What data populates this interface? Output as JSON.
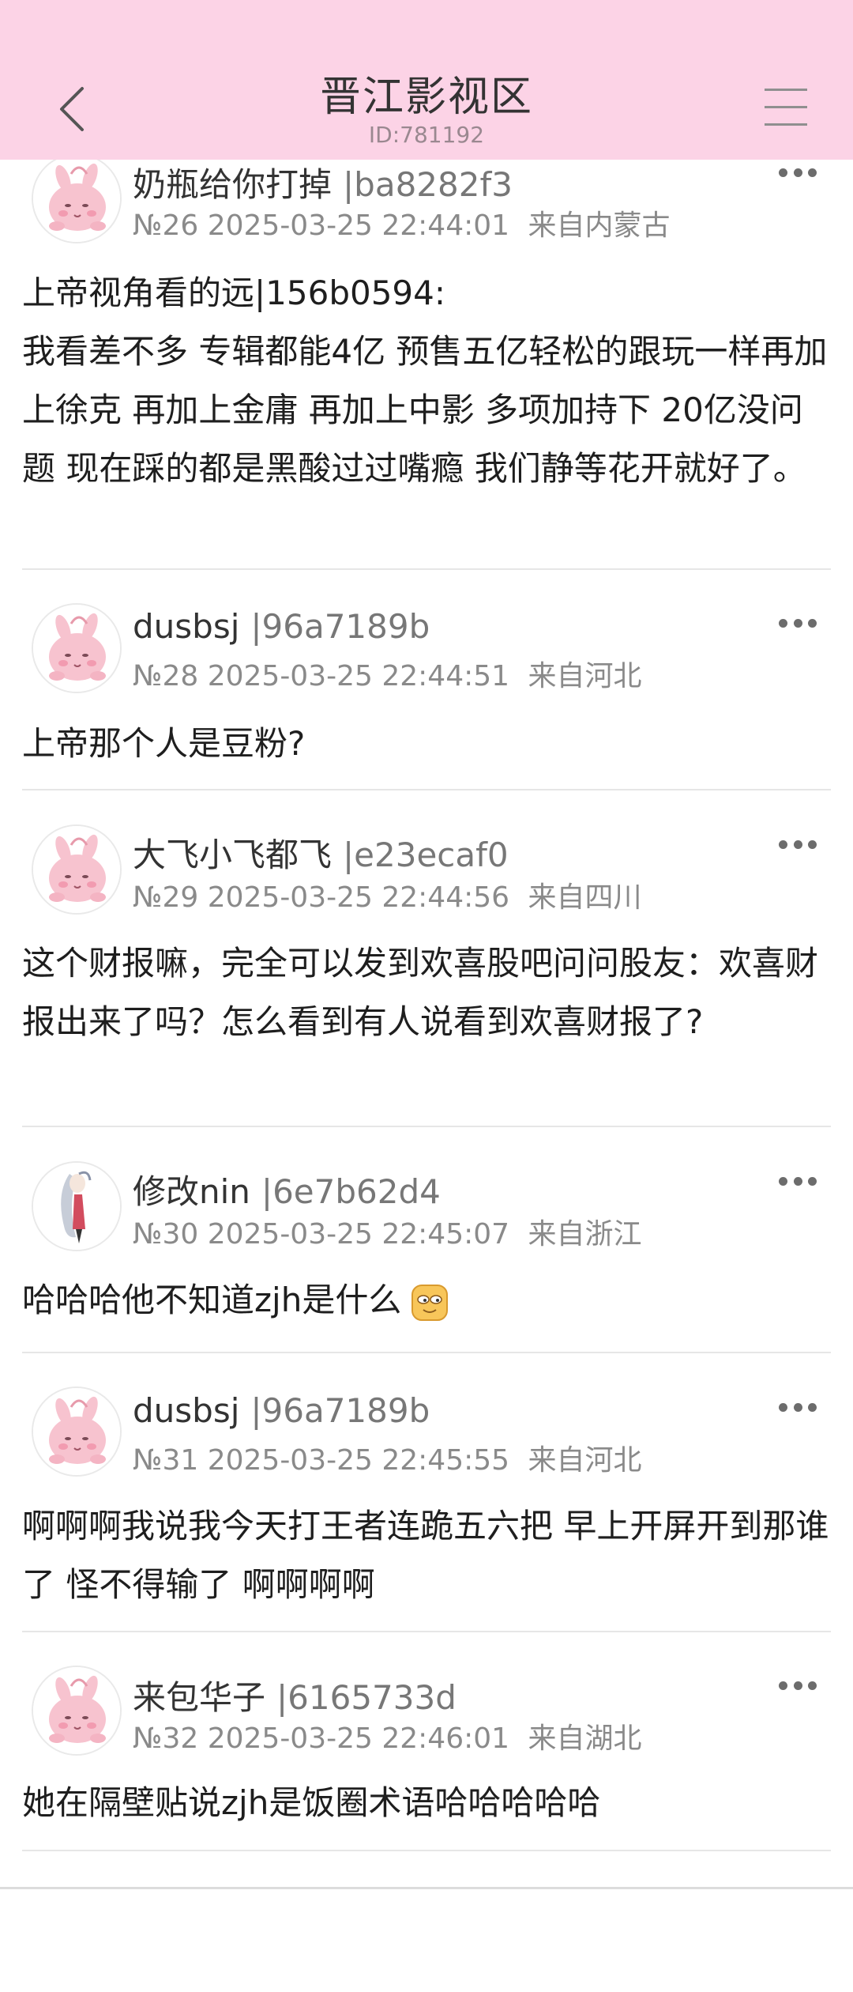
{
  "header": {
    "title": "晋江影视区",
    "board_id": "ID:781192",
    "background": "#fcd3e6"
  },
  "icons": {
    "back": "chevron-left-icon",
    "menu": "hamburger-menu-icon",
    "more": "more-dots-icon",
    "avatar_default": "pink-bunny-avatar",
    "avatar_alt": "anime-character-avatar",
    "emoji": "smug-face-emoji"
  },
  "posts": [
    {
      "username": "奶瓶给你打掉",
      "uid": "|ba8282f3",
      "floor": "№26",
      "time": "2025-03-25 22:44:01",
      "location": "来自内蒙古",
      "lines": [
        "上帝视角看的远|156b0594:",
        "我看差不多 专辑都能4亿 预售五亿轻松的跟玩一样再加上徐克 再加上金庸 再加上中影 多项加持下 20亿没问题 现在踩的都是黑酸过过嘴瘾 我们静等花开就好了。"
      ]
    },
    {
      "username": "dusbsj",
      "uid": "|96a7189b",
      "floor": "№28",
      "time": "2025-03-25 22:44:51",
      "location": "来自河北",
      "lines": [
        "上帝那个人是豆粉?"
      ]
    },
    {
      "username": "大飞小飞都飞",
      "uid": "|e23ecaf0",
      "floor": "№29",
      "time": "2025-03-25 22:44:56",
      "location": "来自四川",
      "lines": [
        "这个财报嘛，完全可以发到欢喜股吧问问股友：欢喜财报出来了吗？怎么看到有人说看到欢喜财报了?"
      ]
    },
    {
      "username": "修改nin",
      "uid": "|6e7b62d4",
      "floor": "№30",
      "time": "2025-03-25 22:45:07",
      "location": "来自浙江",
      "lines": [
        "哈哈哈他不知道zjh是什么"
      ]
    },
    {
      "username": "dusbsj",
      "uid": "|96a7189b",
      "floor": "№31",
      "time": "2025-03-25 22:45:55",
      "location": "来自河北",
      "lines": [
        "啊啊啊我说我今天打王者连跪五六把 早上开屏开到那谁了 怪不得输了 啊啊啊啊"
      ]
    },
    {
      "username": "来包华子",
      "uid": "|6165733d",
      "floor": "№32",
      "time": "2025-03-25 22:46:01",
      "location": "来自湖北",
      "lines": [
        "她在隔壁贴说zjh是饭圈术语哈哈哈哈哈"
      ]
    }
  ]
}
